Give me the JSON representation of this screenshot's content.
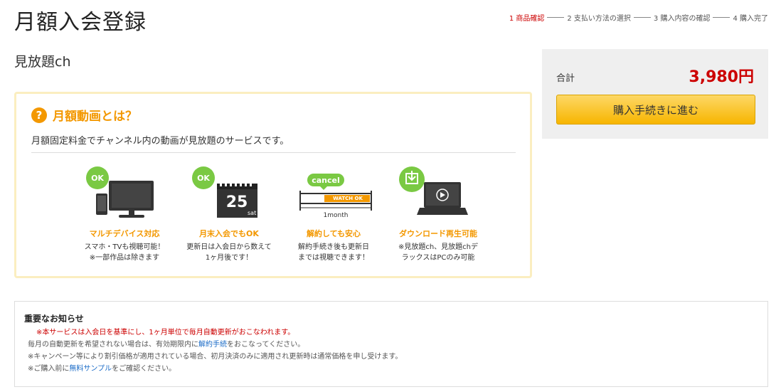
{
  "page": {
    "title": "月額入会登録"
  },
  "steps": [
    {
      "label": "1 商品確認",
      "active": true
    },
    {
      "label": "2 支払い方法の選択",
      "active": false
    },
    {
      "label": "3 購入内容の確認",
      "active": false
    },
    {
      "label": "4 購入完了",
      "active": false
    }
  ],
  "product": {
    "name": "見放題ch"
  },
  "info": {
    "title": "月額動画とは？",
    "question_mark": "?",
    "description": "月額固定料金でチャンネル内の動画が見放題のサービスです。",
    "features": [
      {
        "title": "マルチデバイス対応",
        "desc": "スマホ・TVも視聴可能！\n※一部作品は除きます",
        "badge": "OK",
        "icon": "tv-phone-icon"
      },
      {
        "title": "月末入会でもOK",
        "desc": "更新日は入会日から数えて\n1ヶ月後です！",
        "badge": "OK",
        "calendar_day": "25",
        "calendar_weekday": "sat",
        "icon": "calendar-icon"
      },
      {
        "title": "解約しても安心",
        "desc": "解約手続き後も更新日\nまでは視聴できます！",
        "badge": "cancel",
        "bar_label": "WATCH OK",
        "bar_caption": "1month",
        "icon": "month-bar-icon"
      },
      {
        "title": "ダウンロード再生可能",
        "desc": "※見放題ch、見放題chデ\nラックスはPCのみ可能",
        "icon": "laptop-download-icon"
      }
    ]
  },
  "summary": {
    "total_label": "合計",
    "total_price": "3,980円",
    "button_label": "購入手続きに進む"
  },
  "notice": {
    "title": "重要なお知らせ",
    "line1": "※本サービスは入会日を基準にし、1ヶ月単位で毎月自動更新がおこなわれます。",
    "line2_pre": "毎月の自動更新を希望されない場合は、有効期限内に",
    "line2_link": "解約手続",
    "line2_post": "をおこなってください。",
    "line3": "※キャンペーン等により割引価格が適用されている場合、初月決済のみに適用され更新時は通常価格を申し受けます。",
    "line4_pre": "※ご購入前に",
    "line4_link": "無料サンプル",
    "line4_post": "をご確認ください。"
  },
  "colors": {
    "accent": "#f39800",
    "price": "#cc0000",
    "ok_green": "#7ac943",
    "link": "#1a6bc7"
  }
}
